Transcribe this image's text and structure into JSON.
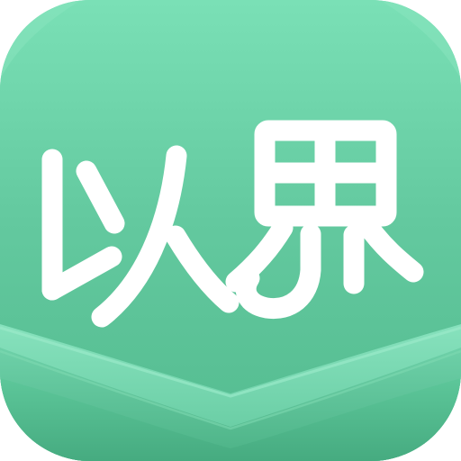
{
  "app_icon": {
    "logo_text": "以界",
    "colors": {
      "background_top": "#74dbb1",
      "background_bottom": "#55bd91",
      "wave_light": "#8be4c1",
      "wave_mid": "#69cfa6",
      "wave_dark": "#4eb387",
      "glyph": "#ffffff"
    }
  }
}
